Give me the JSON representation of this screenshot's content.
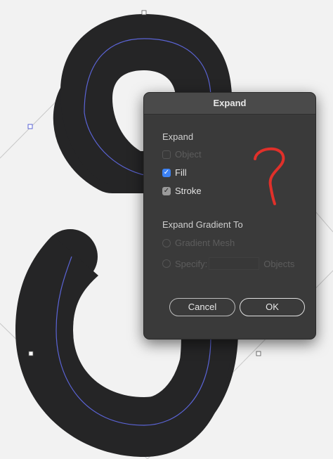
{
  "dialog": {
    "title": "Expand",
    "expand_section": "Expand",
    "options": [
      {
        "label": "Object",
        "checked": false,
        "enabled": false
      },
      {
        "label": "Fill",
        "checked": true,
        "enabled": true
      },
      {
        "label": "Stroke",
        "checked": true,
        "enabled": true
      }
    ],
    "gradient_section": "Expand Gradient To",
    "gradient_mesh": "Gradient Mesh",
    "specify": "Specify:",
    "objects": "Objects",
    "cancel": "Cancel",
    "ok": "OK"
  },
  "annotation": {
    "text": "?",
    "color": "#e0302a"
  },
  "colors": {
    "shape": "#252526",
    "path": "#5b64d6",
    "canvas": "#f2f2f2"
  }
}
